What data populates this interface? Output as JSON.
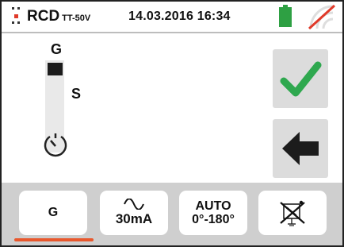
{
  "header": {
    "function_name": "RCD",
    "function_sub": "TT-50V",
    "datetime": "14.03.2016 16:34",
    "icons": [
      "rcd-function-icon",
      "battery-icon",
      "no-signal-icon"
    ],
    "battery_color": "#2ea043"
  },
  "main": {
    "slider_top_label": "G",
    "slider_side_label": "S",
    "slider_selected": "G",
    "icons": [
      "timer-icon"
    ],
    "ok_icon": "checkmark-icon",
    "ok_color": "#2fa84f",
    "back_icon": "back-arrow-icon"
  },
  "tabs": [
    {
      "label": "G",
      "selected": true
    },
    {
      "label": "30mA",
      "icon": "sine-wave-icon"
    },
    {
      "line1": "AUTO",
      "line2": "0°-180°"
    },
    {
      "icon": "rcd-disabled-icon"
    }
  ],
  "accent_color": "#e8582d"
}
